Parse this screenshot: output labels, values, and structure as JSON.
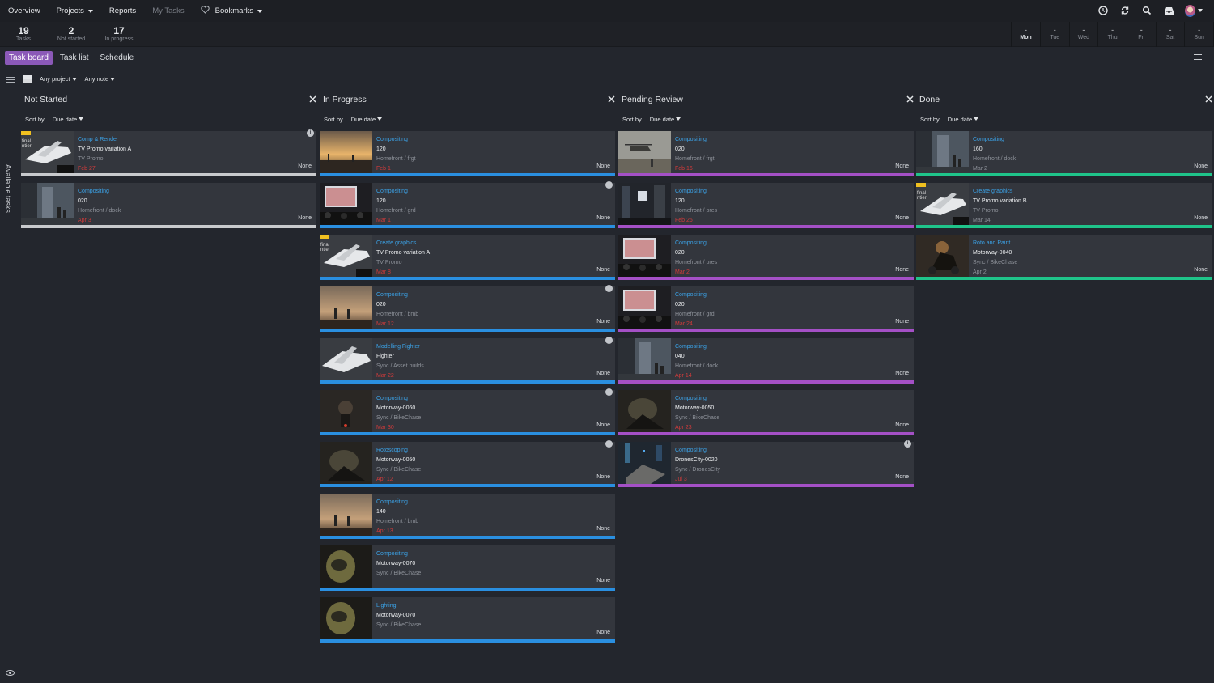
{
  "nav": {
    "items": [
      {
        "label": "Overview",
        "caret": false,
        "dim": false
      },
      {
        "label": "Projects",
        "caret": true,
        "dim": false
      },
      {
        "label": "Reports",
        "caret": false,
        "dim": false
      },
      {
        "label": "My Tasks",
        "caret": false,
        "dim": true
      },
      {
        "label": "Bookmarks",
        "caret": true,
        "dim": false,
        "icon": "heart-icon"
      }
    ],
    "right_icons": [
      "clock-icon",
      "sync-icon",
      "search-icon",
      "inbox-icon",
      "user-avatar"
    ]
  },
  "stats": [
    {
      "num": "19",
      "label": "Tasks"
    },
    {
      "num": "2",
      "label": "Not started"
    },
    {
      "num": "17",
      "label": "In progress"
    }
  ],
  "days": [
    {
      "dash": "-",
      "name": "Mon",
      "active": true
    },
    {
      "dash": "-",
      "name": "Tue",
      "active": false
    },
    {
      "dash": "-",
      "name": "Wed",
      "active": false
    },
    {
      "dash": "-",
      "name": "Thu",
      "active": false
    },
    {
      "dash": "-",
      "name": "Fri",
      "active": false
    },
    {
      "dash": "-",
      "name": "Sat",
      "active": false
    },
    {
      "dash": "-",
      "name": "Sun",
      "active": false
    }
  ],
  "tabs": [
    {
      "label": "Task board",
      "active": true
    },
    {
      "label": "Task list",
      "active": false
    },
    {
      "label": "Schedule",
      "active": false
    }
  ],
  "rail": {
    "label": "Available tasks"
  },
  "filters": {
    "project": "Any project",
    "note": "Any note"
  },
  "colors": {
    "accent": "#8b59b8",
    "task_link": "#3ba3e8",
    "overdue": "#d03b3b",
    "not_started": "#c8cacd",
    "in_progress": "#2a8fe0",
    "pending_review": "#a450c6",
    "done": "#1fc48a"
  },
  "columns": [
    {
      "title": "Not Started",
      "sort_label": "Sort by",
      "sort_value": "Due date",
      "bar": "bar-ns",
      "cards": [
        {
          "task": "Comp & Render",
          "name": "TV Promo variation A",
          "path": "TV Promo",
          "date": "Feb 27",
          "late": true,
          "status": "None",
          "info": true,
          "thumb": "jet"
        },
        {
          "task": "Compositing",
          "name": "020",
          "path": "Homefront / dock",
          "date": "Apr 3",
          "late": true,
          "status": "None",
          "info": false,
          "thumb": "dock"
        }
      ]
    },
    {
      "title": "In Progress",
      "sort_label": "Sort by",
      "sort_value": "Due date",
      "bar": "bar-ip",
      "cards": [
        {
          "task": "Compositing",
          "name": "120",
          "path": "Homefront / frgt",
          "date": "Feb 1",
          "late": true,
          "status": "None",
          "info": false,
          "thumb": "sunset"
        },
        {
          "task": "Compositing",
          "name": "120",
          "path": "Homefront / grd",
          "date": "Mar 1",
          "late": true,
          "status": "None",
          "info": true,
          "thumb": "crowd"
        },
        {
          "task": "Create graphics",
          "name": "TV Promo variation A",
          "path": "TV Promo",
          "date": "Mar 8",
          "late": true,
          "status": "None",
          "info": false,
          "thumb": "jet"
        },
        {
          "task": "Compositing",
          "name": "020",
          "path": "Homefront / bmb",
          "date": "Mar 12",
          "late": true,
          "status": "None",
          "info": true,
          "thumb": "smoke"
        },
        {
          "task": "Modelling Fighter",
          "name": "Fighter",
          "path": "Sync / Asset builds",
          "date": "Mar 22",
          "late": true,
          "status": "None",
          "info": true,
          "thumb": "fighter"
        },
        {
          "task": "Compositing",
          "name": "Motorway-0060",
          "path": "Sync / BikeChase",
          "date": "Mar 30",
          "late": true,
          "status": "None",
          "info": true,
          "thumb": "bike"
        },
        {
          "task": "Rotoscoping",
          "name": "Motorway-0050",
          "path": "Sync / BikeChase",
          "date": "Apr 12",
          "late": true,
          "status": "None",
          "info": true,
          "thumb": "rider"
        },
        {
          "task": "Compositing",
          "name": "140",
          "path": "Homefront / bmb",
          "date": "Apr 13",
          "late": true,
          "status": "None",
          "info": false,
          "thumb": "smoke"
        },
        {
          "task": "Compositing",
          "name": "Motorway-0070",
          "path": "Sync / BikeChase",
          "date": "",
          "late": false,
          "status": "None",
          "info": false,
          "thumb": "helmet"
        },
        {
          "task": "Lighting",
          "name": "Motorway-0070",
          "path": "Sync / BikeChase",
          "date": "",
          "late": false,
          "status": "None",
          "info": false,
          "thumb": "helmet"
        }
      ]
    },
    {
      "title": "Pending Review",
      "sort_label": "Sort by",
      "sort_value": "Due date",
      "bar": "bar-pr",
      "cards": [
        {
          "task": "Compositing",
          "name": "020",
          "path": "Homefront / frgt",
          "date": "Feb 16",
          "late": true,
          "status": "None",
          "info": false,
          "thumb": "heli"
        },
        {
          "task": "Compositing",
          "name": "120",
          "path": "Homefront / pres",
          "date": "Feb 26",
          "late": true,
          "status": "None",
          "info": false,
          "thumb": "city"
        },
        {
          "task": "Compositing",
          "name": "020",
          "path": "Homefront / pres",
          "date": "Mar 2",
          "late": true,
          "status": "None",
          "info": false,
          "thumb": "crowd"
        },
        {
          "task": "Compositing",
          "name": "020",
          "path": "Homefront / grd",
          "date": "Mar 24",
          "late": true,
          "status": "None",
          "info": false,
          "thumb": "crowd"
        },
        {
          "task": "Compositing",
          "name": "040",
          "path": "Homefront / dock",
          "date": "Apr 14",
          "late": true,
          "status": "None",
          "info": false,
          "thumb": "dock"
        },
        {
          "task": "Compositing",
          "name": "Motorway-0050",
          "path": "Sync / BikeChase",
          "date": "Apr 23",
          "late": true,
          "status": "None",
          "info": false,
          "thumb": "rider"
        },
        {
          "task": "Compositing",
          "name": "DronesCity-0020",
          "path": "Sync / DronesCity",
          "date": "Jul 3",
          "late": true,
          "status": "None",
          "info": true,
          "thumb": "drone"
        }
      ]
    },
    {
      "title": "Done",
      "sort_label": "Sort by",
      "sort_value": "Due date",
      "bar": "bar-dn",
      "cards": [
        {
          "task": "Compositing",
          "name": "160",
          "path": "Homefront / dock",
          "date": "Mar 2",
          "late": false,
          "status": "None",
          "info": false,
          "thumb": "dock"
        },
        {
          "task": "Create graphics",
          "name": "TV Promo variation B",
          "path": "TV Promo",
          "date": "Mar 14",
          "late": false,
          "status": "None",
          "info": false,
          "thumb": "jet"
        },
        {
          "task": "Roto and Paint",
          "name": "Motorway-0040",
          "path": "Sync / BikeChase",
          "date": "Apr 2",
          "late": false,
          "status": "None",
          "info": false,
          "thumb": "bike2"
        }
      ]
    }
  ]
}
